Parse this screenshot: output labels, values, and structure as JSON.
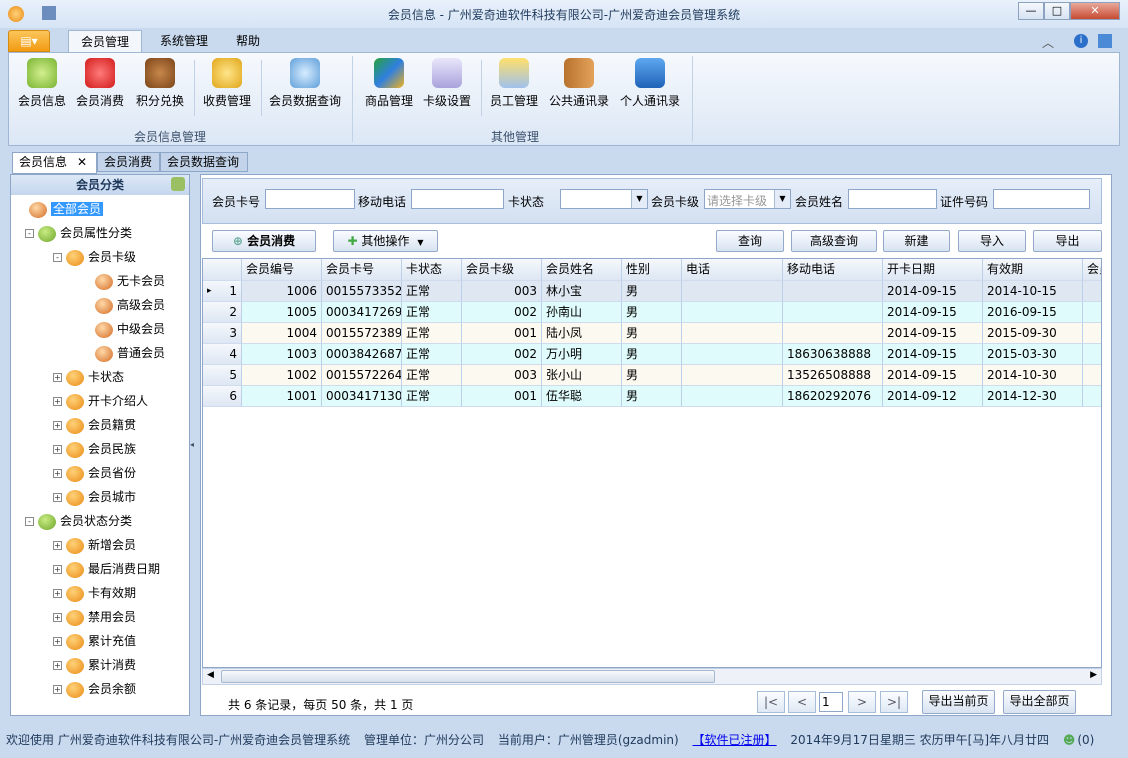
{
  "window": {
    "title": "会员信息 - 广州爱奇迪软件科技有限公司-广州爱奇迪会员管理系统",
    "min": "—",
    "max": "□",
    "close": "✕"
  },
  "ribbon": {
    "tabs": [
      "会员管理",
      "系统管理",
      "帮助"
    ],
    "groups": [
      {
        "label": "会员信息管理",
        "buttons": [
          "会员信息",
          "会员消费",
          "积分兑换",
          "收费管理",
          "会员数据查询"
        ]
      },
      {
        "label": "其他管理",
        "buttons": [
          "商品管理",
          "卡级设置",
          "员工管理",
          "公共通讯录",
          "个人通讯录"
        ]
      }
    ]
  },
  "doc_tabs": [
    "会员信息",
    "会员消费",
    "会员数据查询"
  ],
  "tree": {
    "title": "会员分类",
    "nodes": [
      "全部会员",
      "会员属性分类",
      "会员卡级",
      "无卡会员",
      "高级会员",
      "中级会员",
      "普通会员",
      "卡状态",
      "开卡介绍人",
      "会员籍贯",
      "会员民族",
      "会员省份",
      "会员城市",
      "会员状态分类",
      "新增会员",
      "最后消费日期",
      "卡有效期",
      "禁用会员",
      "累计充值",
      "累计消费",
      "会员余额"
    ]
  },
  "search": {
    "card_no": "会员卡号",
    "mobile": "移动电话",
    "card_status": "卡状态",
    "card_level": "会员卡级",
    "card_level_placeholder": "请选择卡级",
    "name": "会员姓名",
    "id_no": "证件号码"
  },
  "actions": {
    "consume": "会员消费",
    "other": "其他操作",
    "query": "查询",
    "advanced": "高级查询",
    "new": "新建",
    "import": "导入",
    "export": "导出"
  },
  "grid": {
    "columns": [
      "会员编号",
      "会员卡号",
      "卡状态",
      "会员卡级",
      "会员姓名",
      "性别",
      "电话",
      "移动电话",
      "开卡日期",
      "有效期",
      "会员"
    ],
    "rows": [
      [
        "1",
        "1006",
        "0015573352",
        "正常",
        "003",
        "林小宝",
        "男",
        "",
        "",
        "2014-09-15",
        "2014-10-15"
      ],
      [
        "2",
        "1005",
        "0003417269",
        "正常",
        "002",
        "孙南山",
        "男",
        "",
        "",
        "2014-09-15",
        "2016-09-15"
      ],
      [
        "3",
        "1004",
        "0015572389",
        "正常",
        "001",
        "陆小凤",
        "男",
        "",
        "",
        "2014-09-15",
        "2015-09-30"
      ],
      [
        "4",
        "1003",
        "0003842687",
        "正常",
        "002",
        "万小明",
        "男",
        "",
        "18630638888",
        "2014-09-15",
        "2015-03-30"
      ],
      [
        "5",
        "1002",
        "0015572264",
        "正常",
        "003",
        "张小山",
        "男",
        "",
        "13526508888",
        "2014-09-15",
        "2014-10-30"
      ],
      [
        "6",
        "1001",
        "0003417130",
        "正常",
        "001",
        "伍华聪",
        "男",
        "",
        "18620292076",
        "2014-09-12",
        "2014-12-30"
      ]
    ]
  },
  "pager": {
    "summary": "共 6 条记录，每页 50 条，共 1 页",
    "first": "|<",
    "prev": "<",
    "page": "1",
    "next": ">",
    "last": ">|",
    "export_current": "导出当前页",
    "export_all": "导出全部页"
  },
  "status": {
    "welcome": "欢迎使用 广州爱奇迪软件科技有限公司-广州爱奇迪会员管理系统",
    "unit": "管理单位：广州分公司",
    "user": "当前用户：广州管理员(gzadmin)",
    "registered": "【软件已注册】",
    "date": "2014年9月17日星期三 农历甲午[马]年八月廿四",
    "count": "(0)"
  },
  "colors": {
    "accent": "#f29b12",
    "row_alt1": "#e0fbfb",
    "row_alt2": "#fbf9f0",
    "selected": "#3399ff"
  }
}
